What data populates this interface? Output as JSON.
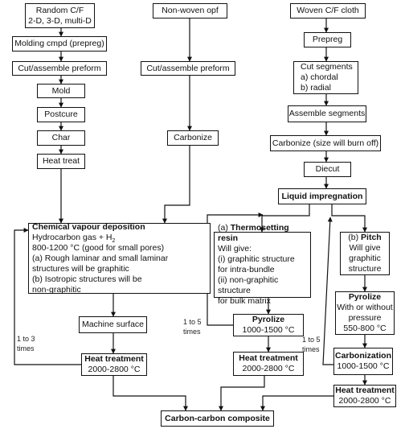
{
  "col1": {
    "random_cf": [
      "Random C/F",
      "2-D, 3-D, multi-D"
    ],
    "molding": "Molding cmpd (prepreg)",
    "cut_assemble": "Cut/assemble preform",
    "mold": "Mold",
    "postcure": "Postcure",
    "char": "Char",
    "heat_treat": "Heat treat"
  },
  "col2": {
    "nonwoven": "Non-woven opf",
    "cut_assemble": "Cut/assemble preform",
    "carbonize": "Carbonize"
  },
  "col3": {
    "woven": "Woven C/F cloth",
    "prepreg": "Prepreg",
    "cut_segments": [
      "Cut segments",
      "a) chordal",
      "b) radial"
    ],
    "assemble": "Assemble segments",
    "carbonize": "Carbonize (size will burn off)",
    "diecut": "Diecut",
    "liquid": "Liquid impregnation"
  },
  "cvd": {
    "title": "Chemical vapour deposition",
    "gas_prefix": "Hydrocarbon gas + H",
    "gas_sub": "2",
    "temp": "800-1200 °C (good for small pores)",
    "line_a1": "(a) Rough laminar and small laminar",
    "line_a2": "structures will be graphitic",
    "line_b1": "(b) Isotropic structures will be",
    "line_b2": "non-graphitic"
  },
  "machine_surface": "Machine surface",
  "ht_left": [
    "Heat treatment",
    "2000-2800 °C"
  ],
  "thermo": {
    "prefix": "(a) ",
    "title": "Thermosetting resin",
    "lines": [
      "Will give:",
      "(i) graphitic structure",
      "for intra-bundle",
      "(ii) non-graphitic structure",
      "for bulk matrix"
    ]
  },
  "pyrolize1": [
    "Pyrolize",
    "1000-1500 °C"
  ],
  "ht_mid": [
    "Heat treatment",
    "2000-2800 °C"
  ],
  "pitch": {
    "prefix": "(b) ",
    "title": "Pitch",
    "lines": [
      "Will give",
      "graphitic",
      "structure"
    ]
  },
  "pyrolize2": [
    "Pyrolize",
    "With or without",
    "pressure",
    "550-800 °C"
  ],
  "carbonization": [
    "Carbonization",
    "1000-1500 °C"
  ],
  "ht_right": [
    "Heat treatment",
    "2000-2800 °C"
  ],
  "composite": "Carbon-carbon composite",
  "loops": {
    "cvd_loop": [
      "1 to 3",
      "times"
    ],
    "thermo_loop": [
      "1 to 5",
      "times"
    ],
    "pitch_loop": [
      "1 to 5",
      "times"
    ]
  }
}
